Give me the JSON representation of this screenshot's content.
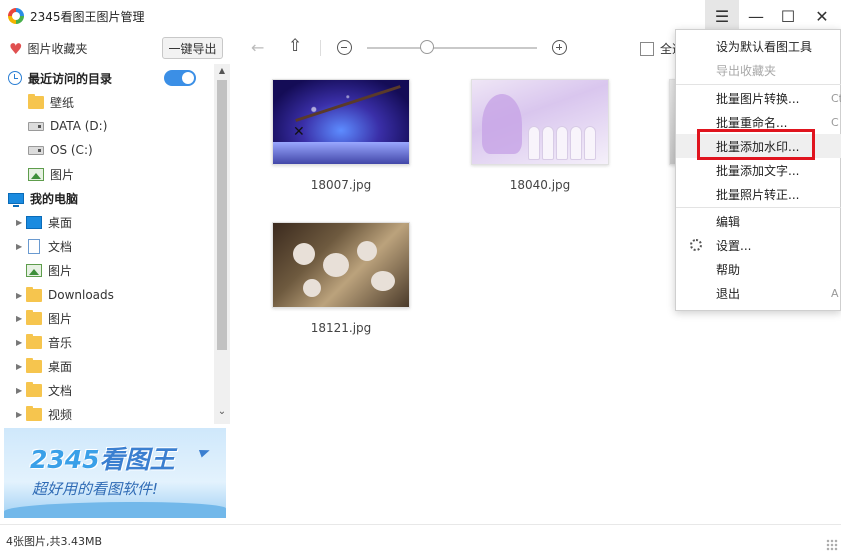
{
  "app": {
    "title": "2345看图王图片管理"
  },
  "window": {
    "menu_icon": "hamburger-icon",
    "minimize_icon": "minimize-icon",
    "maximize_icon": "maximize-icon",
    "close_icon": "close-icon"
  },
  "toolbar": {
    "favorites_label": "图片收藏夹",
    "export_label": "一键导出",
    "select_all_label": "全选",
    "zoom_level": 0.35
  },
  "sidebar": {
    "recent": {
      "title": "最近访问的目录",
      "toggle_on": true,
      "items": [
        {
          "label": "壁纸",
          "icon": "folder-icon"
        },
        {
          "label": "DATA (D:)",
          "icon": "drive-icon"
        },
        {
          "label": "OS (C:)",
          "icon": "drive-icon"
        },
        {
          "label": "图片",
          "icon": "picture-icon"
        }
      ]
    },
    "computer": {
      "title": "我的电脑",
      "items": [
        {
          "label": "桌面",
          "icon": "desktop-icon"
        },
        {
          "label": "文档",
          "icon": "document-icon"
        },
        {
          "label": "图片",
          "icon": "picture-icon"
        },
        {
          "label": "Downloads",
          "icon": "folder-icon"
        },
        {
          "label": "图片",
          "icon": "folder-icon"
        },
        {
          "label": "音乐",
          "icon": "folder-icon"
        },
        {
          "label": "桌面",
          "icon": "folder-icon"
        },
        {
          "label": "文档",
          "icon": "folder-icon"
        },
        {
          "label": "视频",
          "icon": "folder-icon"
        }
      ]
    }
  },
  "banner": {
    "brand_num": "2345",
    "brand_text": "看图王",
    "slogan": "超好用的看图软件!"
  },
  "images": [
    {
      "name": "18007.jpg"
    },
    {
      "name": "18040.jpg"
    },
    {
      "name": "18121.jpg"
    }
  ],
  "menu": {
    "items": [
      {
        "label": "设为默认看图工具",
        "disabled": false
      },
      {
        "label": "导出收藏夹",
        "disabled": true
      },
      {
        "label": "批量图片转换...",
        "shortcut": "Ct"
      },
      {
        "label": "批量重命名...",
        "shortcut": "C"
      },
      {
        "label": "批量添加水印...",
        "highlighted": true
      },
      {
        "label": "批量添加文字..."
      },
      {
        "label": "批量照片转正..."
      },
      {
        "label": "编辑"
      },
      {
        "label": "设置..."
      },
      {
        "label": "帮助"
      },
      {
        "label": "退出",
        "shortcut": "A"
      }
    ]
  },
  "status": {
    "text": "4张图片,共3.43MB"
  },
  "colors": {
    "accent": "#3b8fe6",
    "highlight_box": "#e0141e",
    "folder": "#f6c54e"
  }
}
